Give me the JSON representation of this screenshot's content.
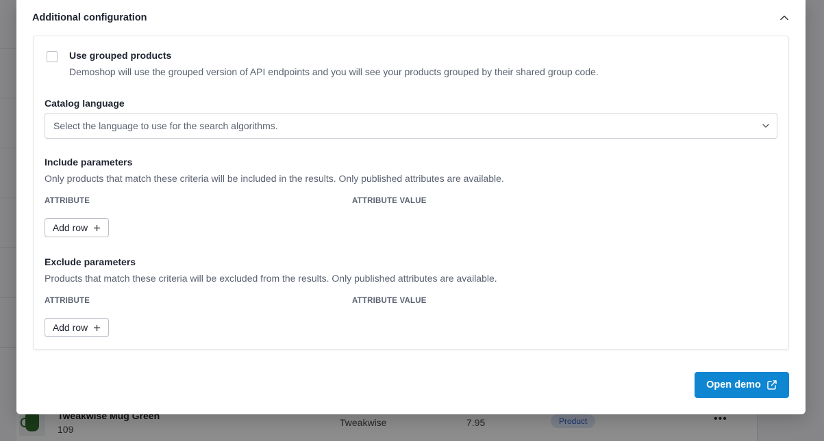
{
  "background": {
    "row": {
      "name": "Tweakwise Mug Green",
      "id": "109",
      "brand": "Tweakwise",
      "price": "7.95",
      "type_badge": "Product",
      "more_label": "•••"
    }
  },
  "modal": {
    "section_title": "Additional configuration",
    "collapse_icon": "chevron-up-icon",
    "grouped": {
      "label": "Use grouped products",
      "description": "Demoshop will use the grouped version of API endpoints and you will see your products grouped by their shared group code.",
      "checked": false
    },
    "catalog_language": {
      "label": "Catalog language",
      "placeholder": "Select the language to use for the search algorithms."
    },
    "include": {
      "title": "Include parameters",
      "description": "Only products that match these criteria will be included in the results. Only published attributes are available.",
      "col_attribute": "ATTRIBUTE",
      "col_value": "ATTRIBUTE VALUE",
      "add_row_label": "Add row"
    },
    "exclude": {
      "title": "Exclude parameters",
      "description": "Products that match these criteria will be excluded from the results. Only published attributes are available.",
      "col_attribute": "ATTRIBUTE",
      "col_value": "ATTRIBUTE VALUE",
      "add_row_label": "Add row"
    },
    "open_demo_label": "Open demo"
  },
  "colors": {
    "primary": "#0f86d1",
    "badge_text": "#2c57c7",
    "badge_bg": "#dfe7f8"
  }
}
